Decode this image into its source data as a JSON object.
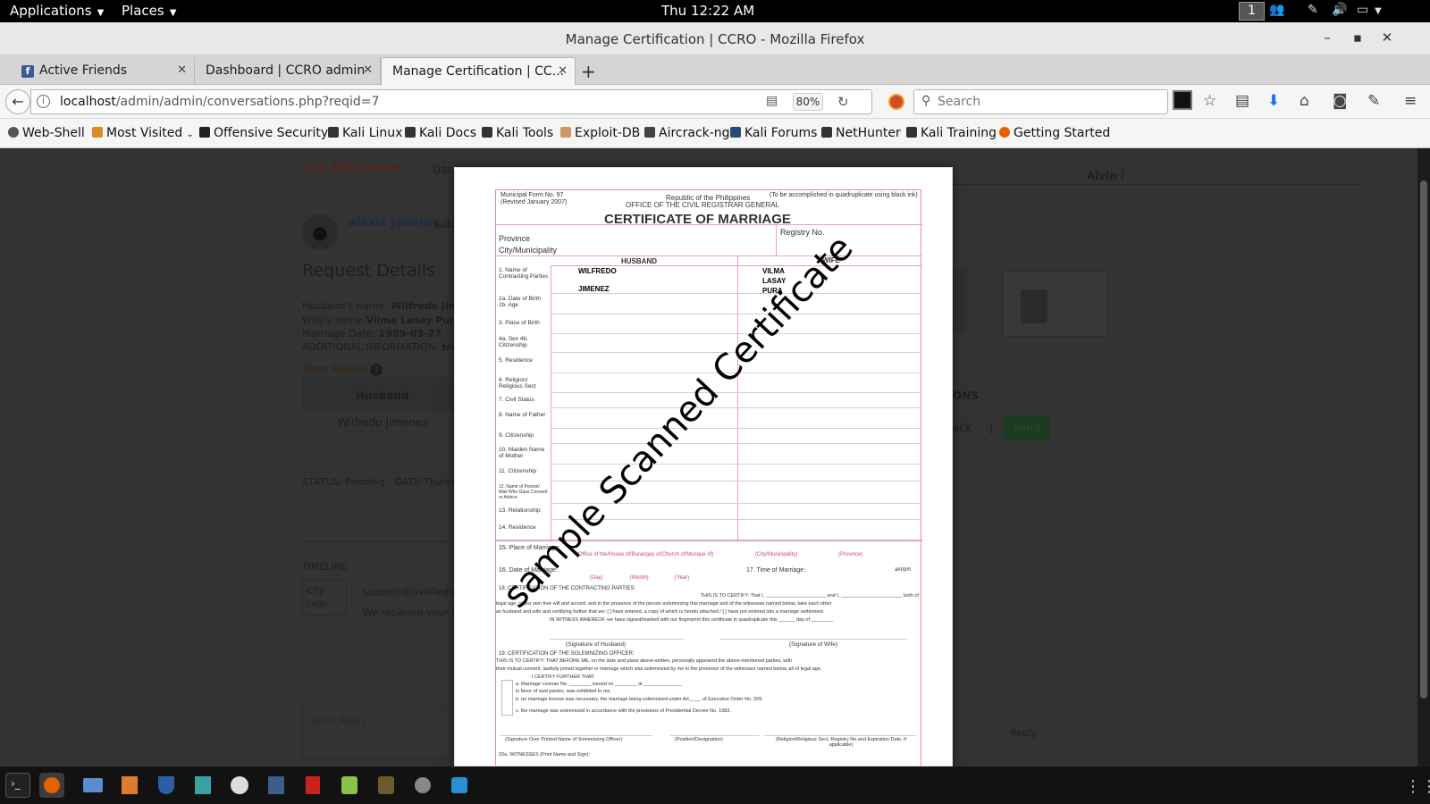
{
  "topbar": {
    "applications": "Applications",
    "places": "Places",
    "clock": "Thu 12:22 AM",
    "workspace": "1"
  },
  "window": {
    "title": "Manage Certification | CCRO - Mozilla Firefox"
  },
  "tabs": [
    {
      "label": "Active Friends"
    },
    {
      "label": "Dashboard | CCRO admin"
    },
    {
      "label": "Manage Certification | CC..."
    }
  ],
  "navbar": {
    "url_host": "localhost",
    "url_path": "/admin/admin/conversations.php?reqid=7",
    "zoom": "80%",
    "search_placeholder": "Search"
  },
  "bookmarks": [
    "Web-Shell",
    "Most Visited",
    "Offensive Security",
    "Kali Linux",
    "Kali Docs",
    "Kali Tools",
    "Exploit-DB",
    "Aircrack-ng",
    "Kali Forums",
    "NetHunter",
    "Kali Training",
    "Getting Started"
  ],
  "page": {
    "brand": "Civil Registration",
    "nav_dash": "Das",
    "user_name": "Alvin",
    "sender": "alexis janoras",
    "sender_suffix": "subm",
    "request_title": "Request Details",
    "husband_label": "Husband's name: ",
    "husband_value": "Wilfredo Jimen",
    "wife_label": "Wife's name:",
    "wife_value": "Vilma Lasay Pura",
    "marriage_label": "Marriage Date: ",
    "marriage_value": "1989-03-27",
    "additional_label": "ADDITIONAL INFORMATION: ",
    "additional_value": "tra",
    "show_results": "Show Results",
    "results_count": "1",
    "col_husband": "Husband",
    "husband_name": "Wilfredo Jimenez",
    "status": "STATUS: Pending - DATE:Thursda",
    "timeline": "TIMELINE",
    "city_logo_1": "City",
    "city_logo_2": "Logo",
    "support_email": "support@civilRegis",
    "received_msg": "We recieved your re",
    "write_reply": "Write Reply",
    "reply": "Reply",
    "ons": "ONS",
    "back": "ack",
    "send": "Send"
  },
  "certificate": {
    "form_no": "Municipal Form No. 97",
    "revised": "(Revised January 2007)",
    "republic": "Republic of the Philippines",
    "office": "OFFICE OF THE CIVIL REGISTRAR GENERAL",
    "quadruplicate": "(To be accomplished in quadruplicate using black ink)",
    "title": "CERTIFICATE OF MARRIAGE",
    "province": "Province",
    "city": "City/Municipality",
    "registry": "Registry No.",
    "husband": "HUSBAND",
    "wife": "WIFE",
    "h_first": "WILFREDO",
    "h_last": "JIMENEZ",
    "w_first": "VILMA",
    "w_middle": "LASAY",
    "w_last": "PURA",
    "rows": [
      "1. Name of Contracting Parties",
      "2a. Date of Birth 2b. Age",
      "3. Place of Birth",
      "4a. Sex 4b. Citizenship",
      "5. Residence",
      "6. Religion/ Religious Sect",
      "7. Civil Status",
      "8. Name of Father",
      "9. Citizenship",
      "10. Maiden Name of Mother",
      "11. Citizenship",
      "12. Name of Person/ Wali Who Gave Consent or Advice",
      "13. Relationship",
      "14. Residence"
    ],
    "place_marriage": "15. Place of Marriage:",
    "place_sub": "(Office of the/House of/Barangay of/Church of/Mosque of)",
    "place_city": "(City/Municipality)",
    "place_prov": "(Province)",
    "date_marriage": "16. Date of Marriage:",
    "time_marriage": "17. Time of Marriage:",
    "ampm": "am/pm",
    "day": "(Day)",
    "month": "(Month)",
    "year": "(Year)",
    "cert18": "18. CERTIFICATION OF THE CONTRACTING PARTIES:",
    "cert18_line1": "THIS IS TO CERTIFY: That I, ______________________ and I, ______________________, both of",
    "cert18_line2": "legal age, of our own free will and accord, and in the presence of the person solemnizing this marriage and of the witnesses named below, take each other",
    "cert18_line3": "as husband and wife and certifying further that we: [ ] have entered, a copy of which is hereto attached / [ ] have not entered into a marriage settlement.",
    "cert18_line4": "IN WITNESS WHEREOF, we have signed/marked with our fingerprint this certificate in quadruplicate this ______ day of ________",
    "sig_husband": "(Signature of Husband)",
    "sig_wife": "(Signature of Wife)",
    "cert19": "19. CERTIFICATION OF THE SOLEMNIZING OFFICER:",
    "cert19_line1": "THIS IS TO CERTIFY: THAT BEFORE ME, on the date and place above-written, personally appeared the above-mentioned parties, with",
    "cert19_line2": "their mutual consent, lawfully joined together in marriage which was solemnized by me in the presence of the witnesses named below, all of legal age.",
    "cert19_line3": "I CERTIFY FURTHER THAT:",
    "cert19_a": "a. Marriage License No. ________ issued on ________ at ______________",
    "cert19_a2": "in favor of said parties, was exhibited to me.",
    "cert19_b": "b. no marriage license was necessary, the marriage being solemnized under Art.____ of Executive Order No. 209.",
    "cert19_c": "c. the marriage was solemnized in accordance with the provisions of Presidential Decree No. 1083.",
    "sig_officer": "(Signature Over Printed Name of Solemnizing Officer)",
    "position": "(Position/Designation)",
    "religion_reg": "(Religion/Religious Sect, Registry No.and Expiration Date, if applicable)",
    "witnesses": "20a. WITNESSES (Print Name and Sign):",
    "watermark": "sample Scanned Certificate"
  },
  "colors": {
    "form_pink": "#e38ea6",
    "brand_red": "#7a1a1a",
    "send_green": "#1e5e2c"
  }
}
